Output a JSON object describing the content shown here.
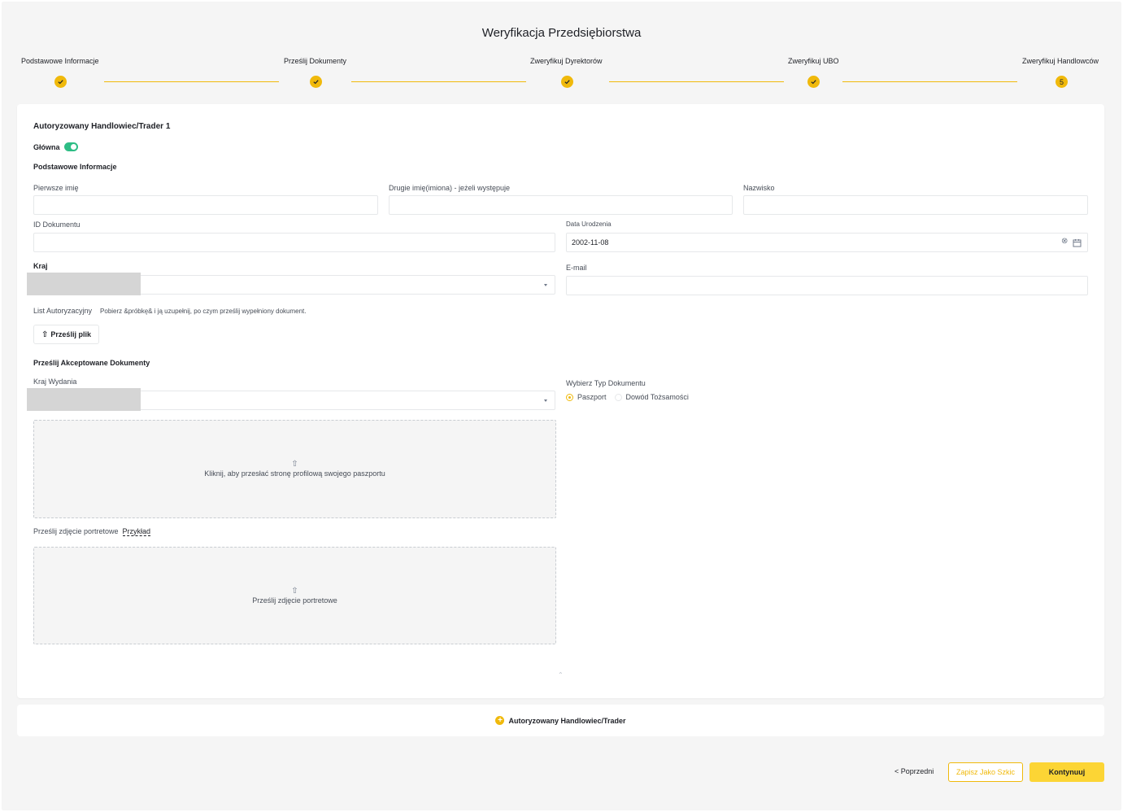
{
  "page": {
    "title": "Weryfikacja Przedsiębiorstwa"
  },
  "stepper": {
    "steps": [
      {
        "label": "Podstawowe Informacje",
        "status": "done"
      },
      {
        "label": "Prześlij Dokumenty",
        "status": "done"
      },
      {
        "label": "Zweryfikuj Dyrektorów",
        "status": "done"
      },
      {
        "label": "Zweryfikuj UBO",
        "status": "done"
      },
      {
        "label": "Zweryfikuj Handlowców",
        "status": "current",
        "number": "5"
      }
    ]
  },
  "trader": {
    "title": "Autoryzowany Handlowiec/Trader 1",
    "main_label": "Główna",
    "main_toggle_on": true,
    "basic_info_title": "Podstawowe Informacje",
    "first_name": {
      "label": "Pierwsze imię",
      "value": ""
    },
    "middle_name": {
      "label": "Drugie imię(imiona) - jeżeli występuje",
      "value": ""
    },
    "last_name": {
      "label": "Nazwisko",
      "value": ""
    },
    "document_id": {
      "label": "ID Dokumentu",
      "value": ""
    },
    "birth_date": {
      "label": "Data Urodzenia",
      "value": "2002-11-08"
    },
    "country": {
      "label": "Kraj",
      "value": ""
    },
    "email": {
      "label": "E-mail",
      "value": ""
    },
    "auth_letter": {
      "label": "List Autoryzacyjny",
      "hint": "Pobierz &próbkę& i ją uzupełnij, po czym prześlij wypełniony dokument.",
      "upload_label": "Prześlij plik"
    },
    "documents": {
      "title": "Prześlij Akceptowane Dokumenty",
      "issue_country_label": "Kraj Wydania",
      "issue_country_value": "",
      "doc_type_label": "Wybierz Typ Dokumentu",
      "doc_types": [
        {
          "label": "Paszport",
          "checked": true
        },
        {
          "label": "Dowód Tożsamości",
          "checked": false
        }
      ],
      "passport_dropzone_text": "Kliknij, aby przesłać stronę profilową swojego paszportu",
      "portrait_label": "Prześlij zdjęcie portretowe",
      "portrait_example": "Przykład",
      "portrait_dropzone_text": "Prześlij zdjęcie portretowe"
    }
  },
  "add_trader_label": "Autoryzowany Handlowiec/Trader",
  "footer": {
    "prev_label": "< Poprzedni",
    "draft_label": "Zapisz Jako Szkic",
    "continue_label": "Kontynuuj"
  },
  "colors": {
    "accent": "#f0b90b",
    "accent_button": "#fcd535",
    "toggle_on": "#2ebd85",
    "background": "#f5f5f5"
  }
}
